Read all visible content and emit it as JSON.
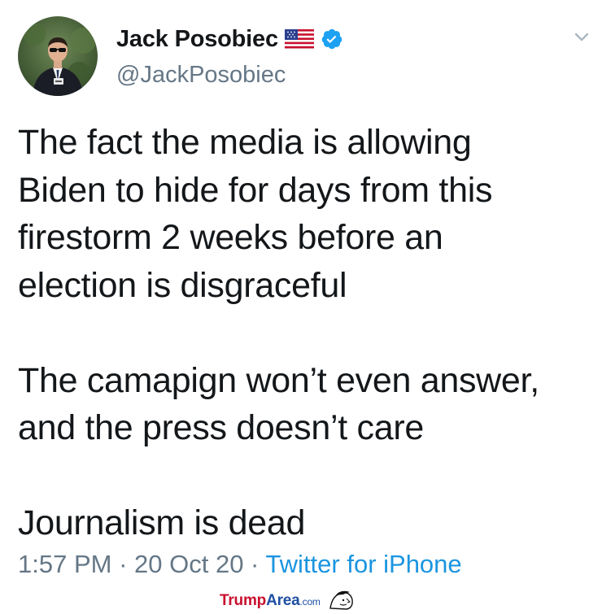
{
  "user": {
    "display_name": "Jack Posobiec",
    "handle": "@JackPosobiec"
  },
  "icons": {
    "flag": "us-flag-icon",
    "verified": "verified-badge-icon",
    "menu": "chevron-down-icon",
    "avatar": "profile-photo"
  },
  "colors": {
    "text": "#14171a",
    "muted": "#657786",
    "link": "#1b95e0",
    "verified": "#1da1f2"
  },
  "tweet": {
    "paragraphs": [
      [
        "The fact the media is allowing",
        "Biden to hide for days from this",
        "firestorm 2 weeks before an",
        "election is disgraceful"
      ],
      [
        "The camapign won’t even answer,",
        "and the press doesn’t care"
      ],
      [
        "Journalism is dead"
      ]
    ]
  },
  "meta": {
    "time": "1:57 PM",
    "separator": " · ",
    "date": "20 Oct 20",
    "source": "Twitter for iPhone"
  },
  "watermark": {
    "part1": "Trump",
    "part2": "Area",
    "suffix": ".com"
  }
}
